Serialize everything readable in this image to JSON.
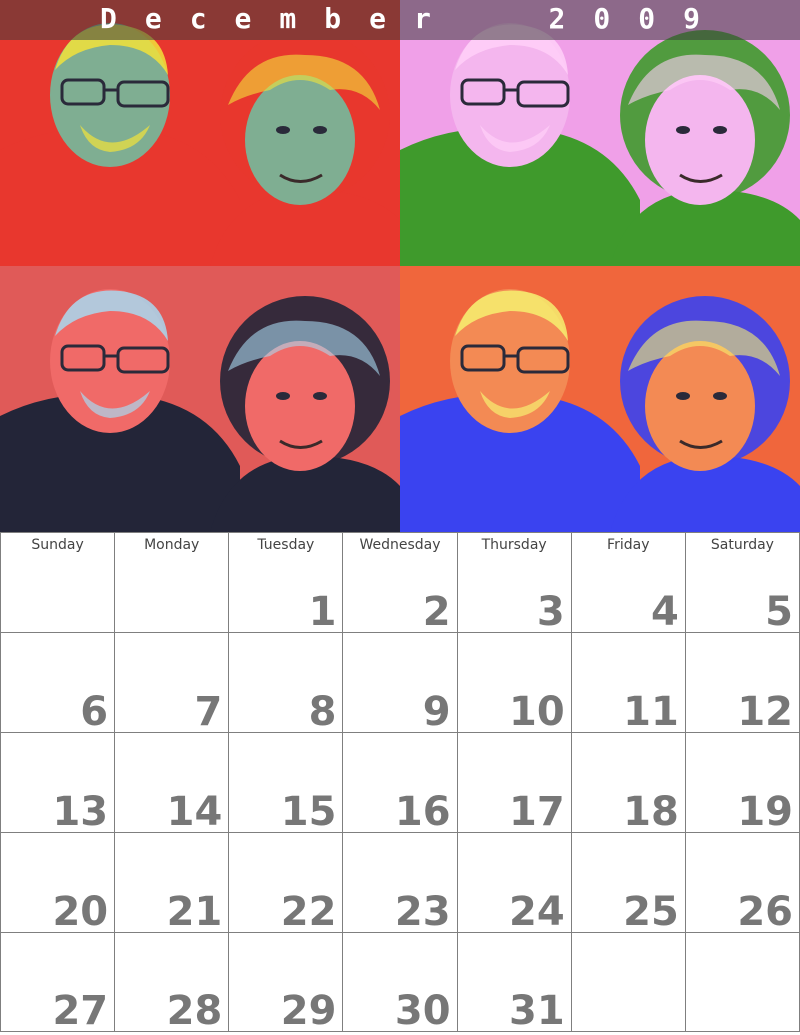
{
  "calendar": {
    "title": "December  2009",
    "weekdays": [
      "Sunday",
      "Monday",
      "Tuesday",
      "Wednesday",
      "Thursday",
      "Friday",
      "Saturday"
    ],
    "weeks": [
      [
        "",
        "",
        "1",
        "2",
        "3",
        "4",
        "5"
      ],
      [
        "6",
        "7",
        "8",
        "9",
        "10",
        "11",
        "12"
      ],
      [
        "13",
        "14",
        "15",
        "16",
        "17",
        "18",
        "19"
      ],
      [
        "20",
        "21",
        "22",
        "23",
        "24",
        "25",
        "26"
      ],
      [
        "27",
        "28",
        "29",
        "30",
        "31",
        "",
        ""
      ]
    ]
  },
  "photos": [
    {
      "name": "photo-panel-mint-red",
      "background": "#e8372e",
      "figure": "#7fae92",
      "shirt": "#e8372e",
      "highlight": "#f2e23a"
    },
    {
      "name": "photo-panel-pink-green",
      "background": "#f0a0e8",
      "figure": "#f4b6ee",
      "shirt": "#3f9a2c",
      "highlight": "#ffd0f8"
    },
    {
      "name": "photo-panel-salmon-navy",
      "background": "#e05a58",
      "figure": "#f06a68",
      "shirt": "#232538",
      "highlight": "#a8d8f0"
    },
    {
      "name": "photo-panel-orange-blue",
      "background": "#f0663c",
      "figure": "#f38a54",
      "shirt": "#3a43f0",
      "highlight": "#f6f070"
    }
  ]
}
